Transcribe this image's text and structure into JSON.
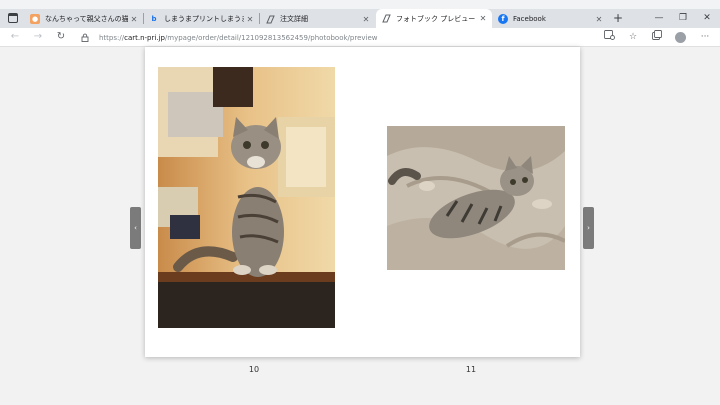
{
  "browser": {
    "tabs": [
      {
        "title": "なんちゃって親父さんの猫日記 -",
        "favicon": "blog-icon",
        "active": false
      },
      {
        "title": "しまうまプリントしまうま - Bing",
        "favicon": "bing-icon",
        "active": false
      },
      {
        "title": "注文詳細",
        "favicon": "page-icon",
        "active": false
      },
      {
        "title": "フォトブック プレビュー",
        "favicon": "page-icon",
        "active": true
      },
      {
        "title": "Facebook",
        "favicon": "facebook-icon",
        "active": false
      }
    ],
    "new_tab": "+",
    "window_controls": {
      "minimize": "—",
      "maximize": "❐",
      "close": "✕"
    },
    "url": {
      "scheme": "https://",
      "host": "cart.n-pri.jp",
      "path": "/mypage/order/detail/121092813562459/photobook/preview"
    }
  },
  "preview": {
    "pages": [
      {
        "number": "10",
        "photo": "cat sitting on a shelf"
      },
      {
        "number": "11",
        "photo": "cat lying on a blanket"
      }
    ],
    "prev_arrow": "‹",
    "next_arrow": "›"
  },
  "colors": {
    "tabbar": "#dee1e6",
    "background": "#f2f2f2",
    "arrow": "#7b7b7b"
  }
}
